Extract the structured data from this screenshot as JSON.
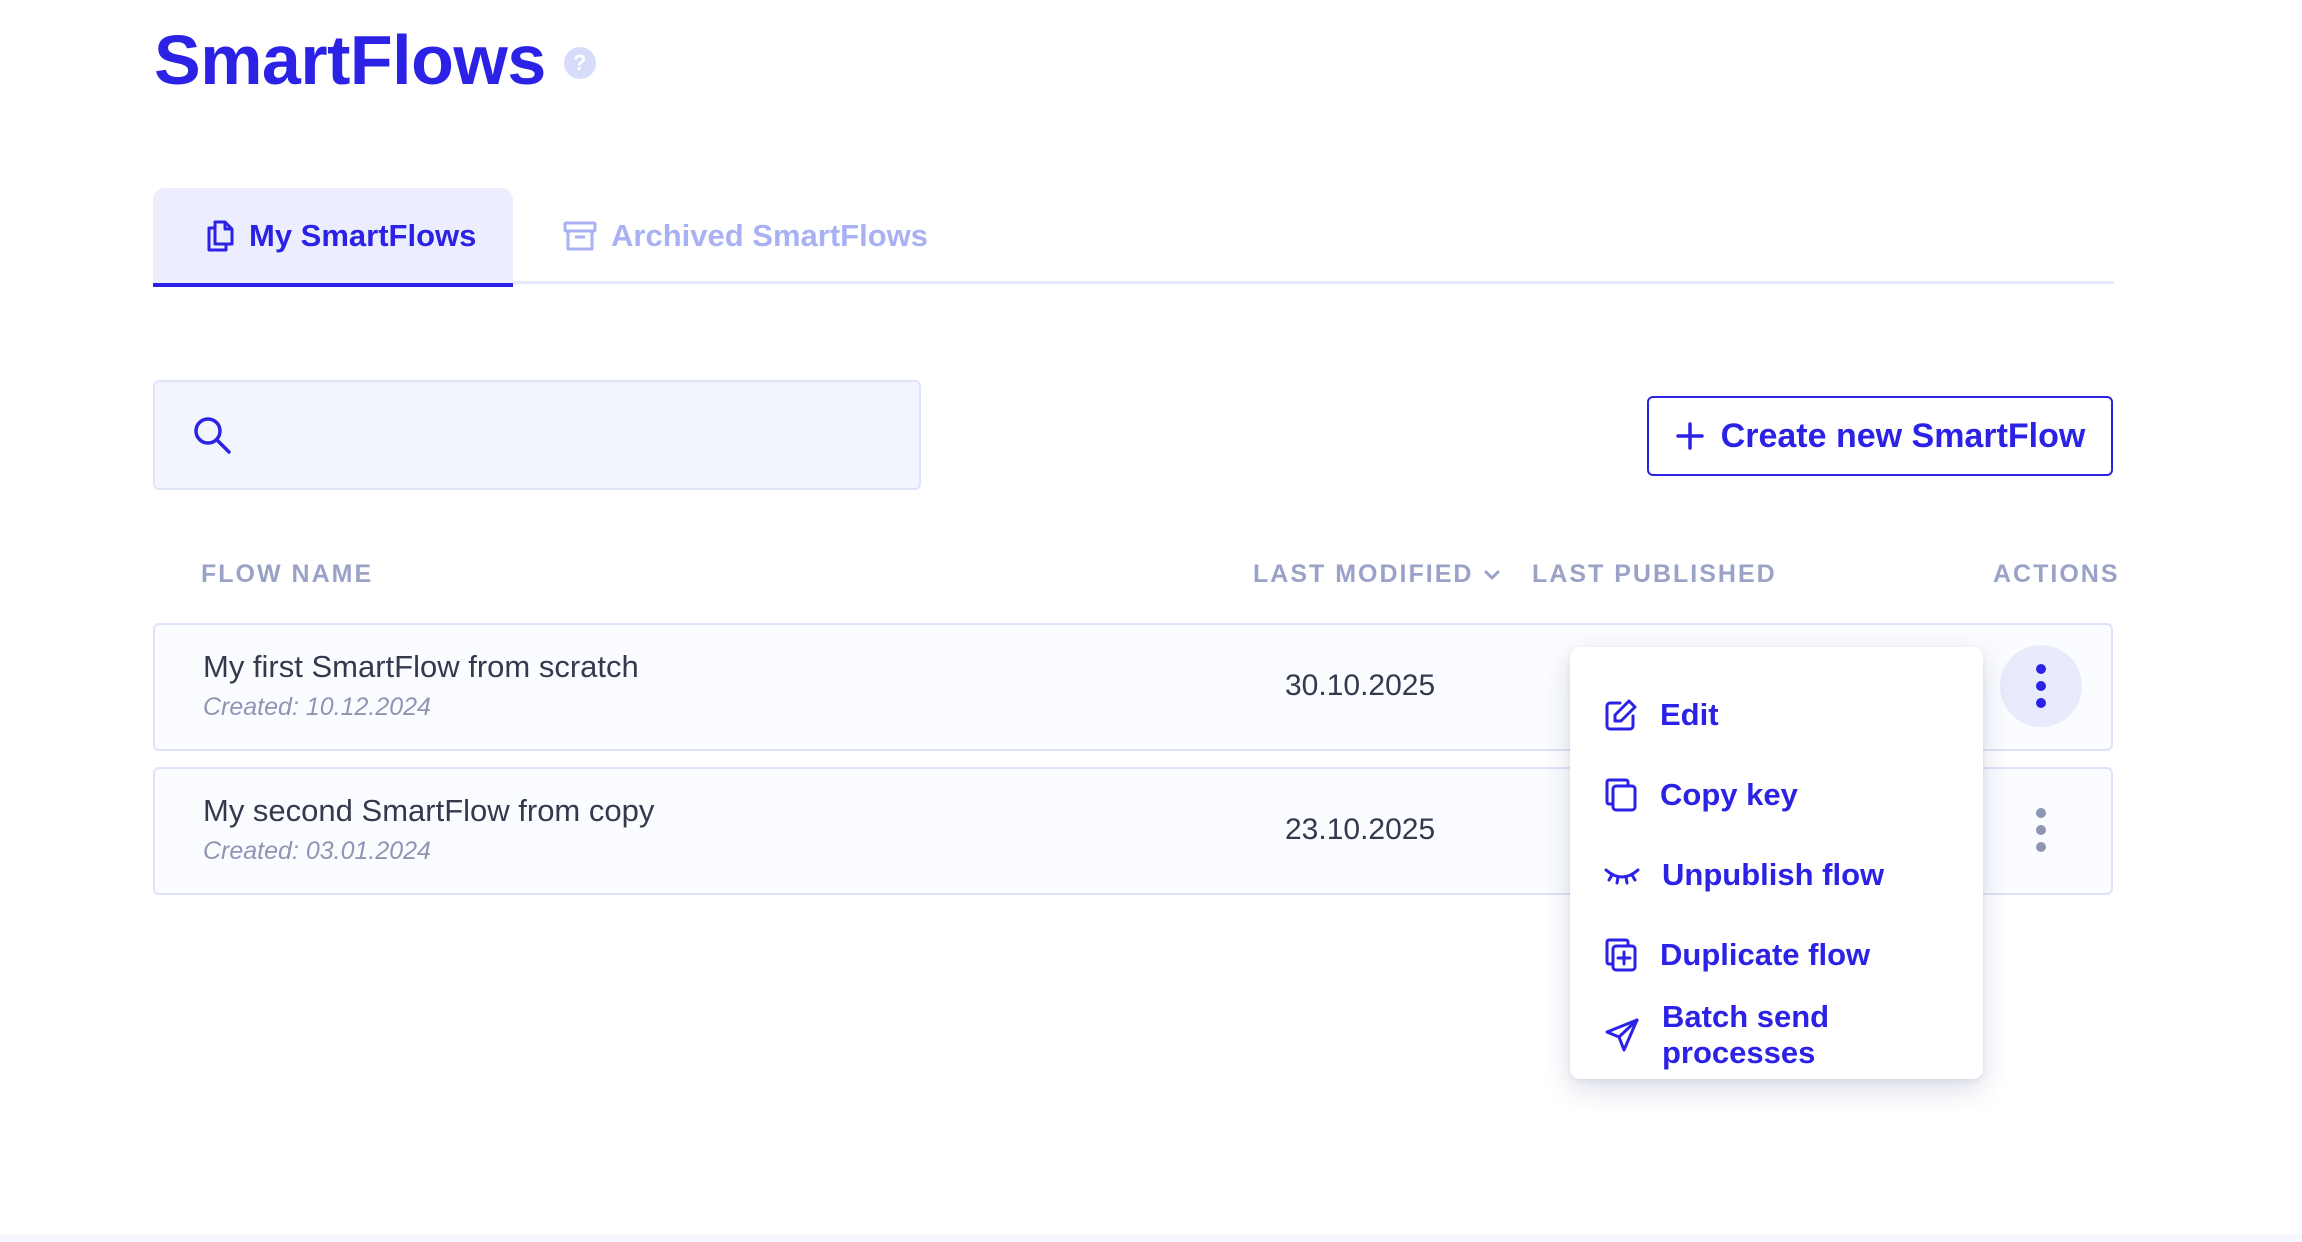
{
  "header": {
    "title": "SmartFlows",
    "help_glyph": "?"
  },
  "tabs": [
    {
      "label": "My SmartFlows",
      "icon": "copy-icon",
      "active": true
    },
    {
      "label": "Archived SmartFlows",
      "icon": "archive-icon",
      "active": false
    }
  ],
  "search": {
    "value": "",
    "placeholder": ""
  },
  "create_button": {
    "label": "Create new SmartFlow",
    "icon": "plus-icon"
  },
  "table": {
    "columns": {
      "name": "FLOW NAME",
      "last_modified": "LAST MODIFIED",
      "last_published": "LAST PUBLISHED",
      "actions": "ACTIONS"
    },
    "sort_column": "last_modified",
    "rows": [
      {
        "name": "My first SmartFlow from scratch",
        "created": "Created: 10.12.2024",
        "last_modified": "30.10.2025",
        "last_published": ""
      },
      {
        "name": "My second SmartFlow from copy",
        "created": "Created: 03.01.2024",
        "last_modified": "23.10.2025",
        "last_published": ""
      }
    ]
  },
  "actions_menu": {
    "items": [
      {
        "label": "Edit",
        "icon": "edit-icon"
      },
      {
        "label": "Copy key",
        "icon": "copy-key-icon"
      },
      {
        "label": "Unpublish flow",
        "icon": "eye-closed-icon"
      },
      {
        "label": "Duplicate flow",
        "icon": "duplicate-icon"
      },
      {
        "label": "Batch send processes",
        "icon": "send-icon"
      }
    ]
  },
  "colors": {
    "accent": "#2b22e6",
    "muted_header": "#9aa3c7",
    "inactive_tab": "#a9b1f3",
    "row_border": "#dfe3f8"
  }
}
